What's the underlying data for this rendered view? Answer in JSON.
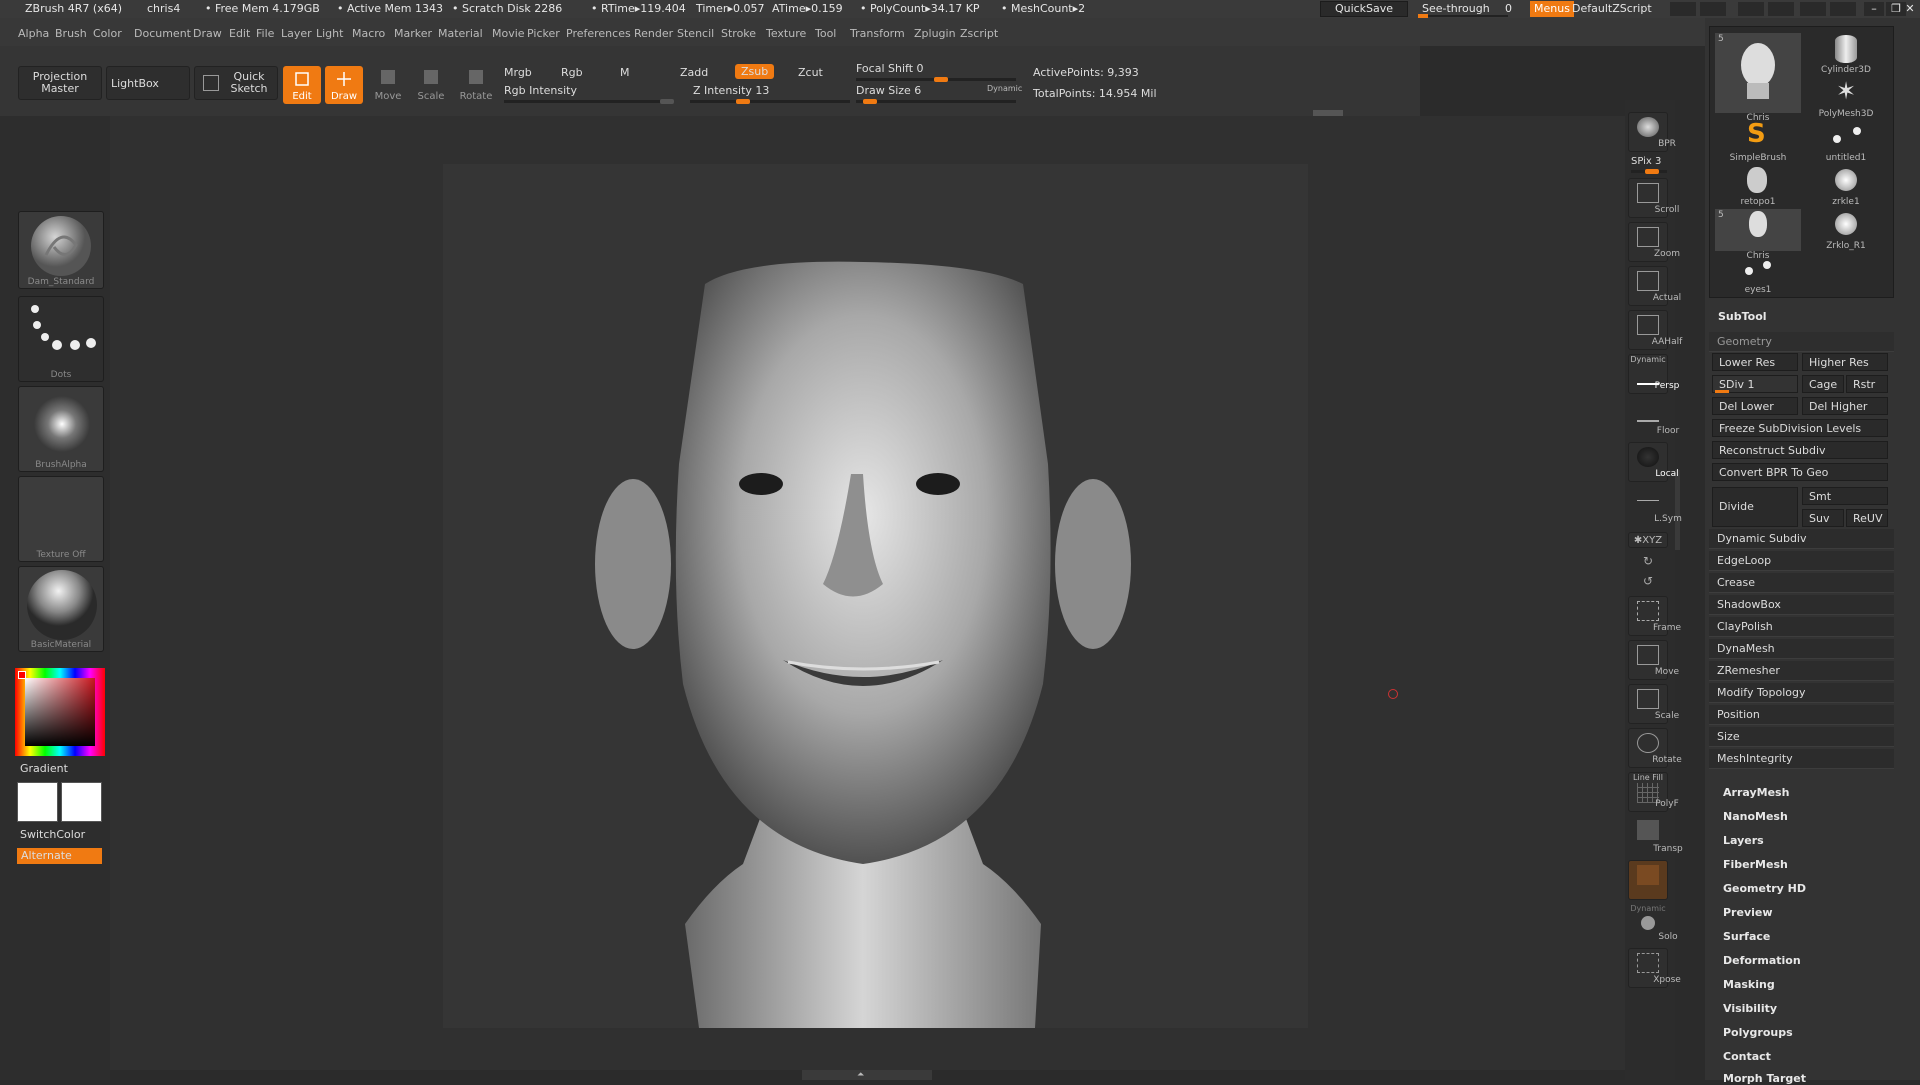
{
  "titlebar": {
    "app": "ZBrush 4R7 (x64)",
    "user": "chris4",
    "free_mem": "• Free Mem 4.179GB",
    "active_mem": "• Active Mem 1343",
    "scratch": "• Scratch Disk 2286",
    "rtime": "• RTime▸119.404",
    "timer": "Timer▸0.057",
    "atime": "ATime▸0.159",
    "polycount": "• PolyCount▸34.17 KP",
    "meshcount": "• MeshCount▸2",
    "quicksave": "QuickSave",
    "seethrough": "See-through",
    "seethrough_val": "0",
    "menus": "Menus",
    "defaultzscript": "DefaultZScript"
  },
  "menubar": [
    "Alpha",
    "Brush",
    "Color",
    "Document",
    "Draw",
    "Edit",
    "File",
    "Layer",
    "Light",
    "Macro",
    "Marker",
    "Material",
    "Movie",
    "Picker",
    "Preferences",
    "Render",
    "Stencil",
    "Stroke",
    "Texture",
    "Tool",
    "Transform",
    "Zplugin",
    "Zscript"
  ],
  "shelf": {
    "projection_master": "Projection Master",
    "lightbox": "LightBox",
    "quick_sketch": "Quick Sketch",
    "edit": "Edit",
    "draw": "Draw",
    "move": "Move",
    "scale": "Scale",
    "rotate": "Rotate",
    "mrgb": "Mrgb",
    "rgb": "Rgb",
    "m": "M",
    "rgb_intensity": "Rgb Intensity",
    "zadd": "Zadd",
    "zsub": "Zsub",
    "zcut": "Zcut",
    "z_intensity": "Z Intensity 13",
    "focal_shift": "Focal Shift 0",
    "draw_size": "Draw Size 6",
    "dynamic": "Dynamic",
    "active_points": "ActivePoints: 9,393",
    "total_points": "TotalPoints: 14.954 Mil"
  },
  "left": {
    "brush": "Dam_Standard",
    "stroke": "Dots",
    "alpha": "BrushAlpha",
    "texture": "Texture Off",
    "material": "BasicMaterial",
    "gradient": "Gradient",
    "switchcolor": "SwitchColor",
    "alternate": "Alternate"
  },
  "rightbar": {
    "bpr": "BPR",
    "spix": "SPix 3",
    "scroll": "Scroll",
    "zoom": "Zoom",
    "actual": "Actual",
    "aahalf": "AAHalf",
    "dynamic_persp_top": "Dynamic",
    "persp": "Persp",
    "floor": "Floor",
    "local": "Local",
    "lsym": "L.Sym",
    "xyz": "✱XYZ",
    "frame": "Frame",
    "move": "Move",
    "scale": "Scale",
    "rotate": "Rotate",
    "linefill": "Line Fill",
    "polyf": "PolyF",
    "transp": "Transp",
    "dynamic_solo_top": "Dynamic",
    "solo": "Solo",
    "xpose": "Xpose"
  },
  "tools": [
    {
      "name": "Chris",
      "badge": "5"
    },
    {
      "name": "Cylinder3D"
    },
    {
      "name": "PolyMesh3D"
    },
    {
      "name": "SimpleBrush"
    },
    {
      "name": "untitled1"
    },
    {
      "name": "retopo1"
    },
    {
      "name": "zrkle1"
    },
    {
      "name": "Chris",
      "badge": "5"
    },
    {
      "name": "Zrklo_R1"
    },
    {
      "name": "eyes1"
    }
  ],
  "subtool_panel": {
    "subtool": "SubTool",
    "geometry": "Geometry",
    "lower_res": "Lower Res",
    "higher_res": "Higher Res",
    "sdiv": "SDiv 1",
    "cage": "Cage",
    "rstr": "Rstr",
    "del_lower": "Del Lower",
    "del_higher": "Del Higher",
    "freeze": "Freeze SubDivision Levels",
    "reconstruct": "Reconstruct Subdiv",
    "convert_bpr": "Convert BPR To Geo",
    "divide": "Divide",
    "smt": "Smt",
    "suv": "Suv",
    "reuv": "ReUV",
    "geo_items": [
      "Dynamic Subdiv",
      "EdgeLoop",
      "Crease",
      "ShadowBox",
      "ClayPolish",
      "DynaMesh",
      "ZRemesher",
      "Modify Topology",
      "Position",
      "Size",
      "MeshIntegrity"
    ],
    "tool_sections": [
      "ArrayMesh",
      "NanoMesh",
      "Layers",
      "FiberMesh",
      "Geometry HD",
      "Preview",
      "Surface",
      "Deformation",
      "Masking",
      "Visibility",
      "Polygroups",
      "Contact",
      "Morph Target"
    ]
  },
  "colors": {
    "accent": "#f07a12",
    "panel": "#333333",
    "viewport": "#303030"
  }
}
